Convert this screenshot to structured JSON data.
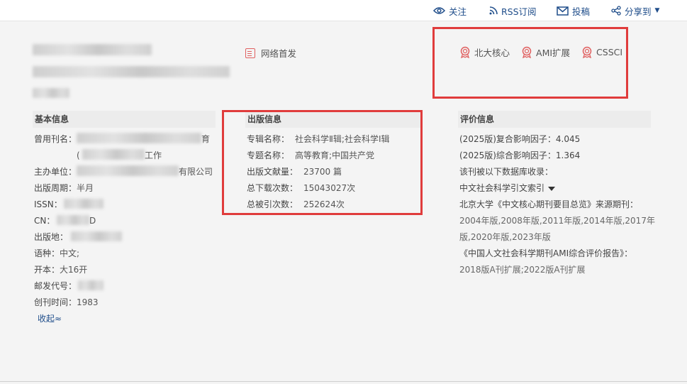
{
  "toolbar": {
    "follow": "关注",
    "rss": "RSS订阅",
    "submit": "投稿",
    "share": "分享到"
  },
  "header": {
    "network_first": "网络首发",
    "tags": [
      "北大核心",
      "AMI扩展",
      "CSSCI"
    ]
  },
  "basic_info": {
    "title": "基本信息",
    "former_name_label": "曾用刊名：",
    "former_name_tail1": "育",
    "former_name_prefix2": "(",
    "former_name_tail2": "工作",
    "sponsor_label": "主办单位：",
    "sponsor_tail": "有限公司",
    "cycle_label": "出版周期：",
    "cycle_value": "半月",
    "issn_label": "ISSN：",
    "cn_label": "CN：",
    "cn_tail": "D",
    "place_label": "出版地：",
    "lang_label": "语种：",
    "lang_value": "中文;",
    "format_label": "开本：",
    "format_value": "大16开",
    "postal_label": "邮发代号：",
    "founded_label": "创刊时间：",
    "founded_value": "1983",
    "collapse": "收起≈"
  },
  "pub_info": {
    "title": "出版信息",
    "rows": [
      {
        "label": "专辑名称：",
        "value": "社会科学Ⅱ辑;社会科学Ⅰ辑"
      },
      {
        "label": "专题名称：",
        "value": "高等教育;中国共产党"
      },
      {
        "label": "出版文献量：",
        "value": "23700 篇"
      },
      {
        "label": "总下载次数：",
        "value": "15043027次"
      },
      {
        "label": "总被引次数：",
        "value": "252624次"
      }
    ]
  },
  "eval_info": {
    "title": "评价信息",
    "composite": "(2025版)复合影响因子：4.045",
    "comprehensive": "(2025版)综合影响因子：1.364",
    "db_label": "该刊被以下数据库收录：",
    "db_select": "中文社会科学引文索引",
    "pku_label": "北京大学《中文核心期刊要目总览》来源期刊：",
    "pku_years_1": "2004年版,2008年版,2011年版,2014年版,2017年",
    "pku_years_2": "版,2020年版,2023年版",
    "ami_label": "《中国人文社会科学期刊AMI综合评价报告》：",
    "ami_value": "2018版A刊扩展;2022版A刊扩展"
  },
  "colors": {
    "link": "#1f4d8a",
    "tag_icon": "#e06060",
    "highlight_box": "#e03c3c"
  }
}
